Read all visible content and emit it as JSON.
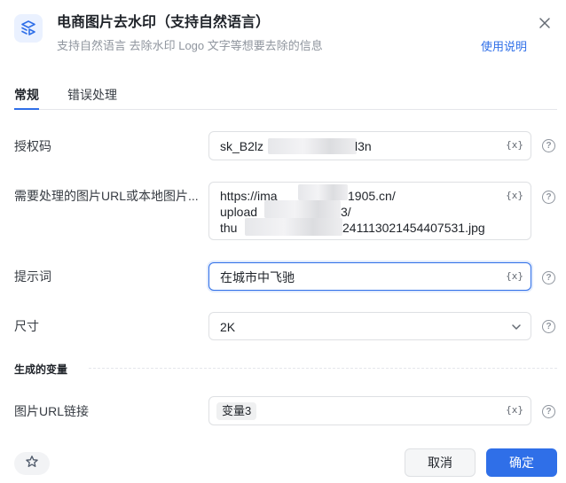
{
  "header": {
    "title": "电商图片去水印（支持自然语言）",
    "subtitle": "支持自然语言 去除水印 Logo 文字等想要去除的信息",
    "help_link": "使用说明"
  },
  "tabs": [
    "常规",
    "错误处理"
  ],
  "fields": {
    "auth": {
      "label": "授权码",
      "value_start": "sk_B2lz",
      "value_end": "l3n"
    },
    "image": {
      "label": "需要处理的图片URL或本地图片...",
      "line1_start": "https://ima",
      "line1_end": "1905.cn/",
      "line2_start": "upload",
      "line2_end": "3/",
      "line3_start": "thu",
      "line3_end": "241113021454407531.jpg"
    },
    "prompt": {
      "label": "提示词",
      "value": "在城市中飞驰"
    },
    "size": {
      "label": "尺寸",
      "value": "2K"
    }
  },
  "variable_icon": "{x}",
  "output": {
    "section_title": "生成的变量",
    "label": "图片URL链接",
    "tag": "变量3"
  },
  "buttons": {
    "cancel": "取消",
    "confirm": "确定"
  },
  "colors": {
    "accent": "#2f6fe8",
    "border": "#dee0e3"
  }
}
